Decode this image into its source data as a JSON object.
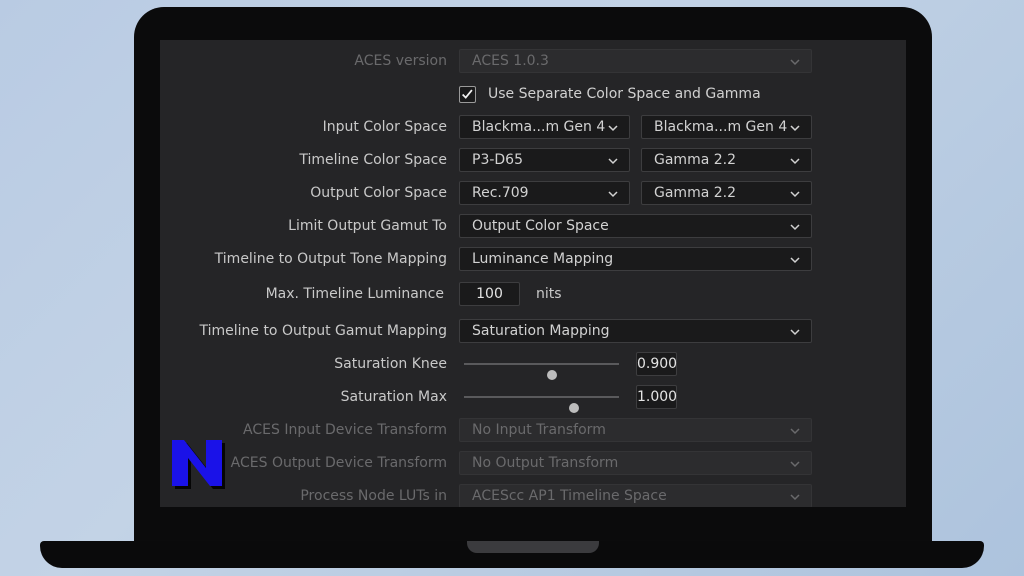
{
  "settings": {
    "aces_version": {
      "label": "ACES version",
      "value": "ACES 1.0.3"
    },
    "separate": {
      "label": "Use Separate Color Space and Gamma",
      "checked": true
    },
    "input_cs": {
      "label": "Input Color Space",
      "space": "Blackma...m Gen 4",
      "gamma": "Blackma...m Gen 4"
    },
    "timeline_cs": {
      "label": "Timeline Color Space",
      "space": "P3-D65",
      "gamma": "Gamma 2.2"
    },
    "output_cs": {
      "label": "Output Color Space",
      "space": "Rec.709",
      "gamma": "Gamma 2.2"
    },
    "limit_gamut": {
      "label": "Limit Output Gamut To",
      "value": "Output Color Space"
    },
    "tone_mapping": {
      "label": "Timeline to Output Tone Mapping",
      "value": "Luminance Mapping"
    },
    "max_luminance": {
      "label": "Max. Timeline Luminance",
      "value": "100",
      "unit": "nits"
    },
    "gamut_mapping": {
      "label": "Timeline to Output Gamut Mapping",
      "value": "Saturation Mapping"
    },
    "sat_knee": {
      "label": "Saturation Knee",
      "value": "0.900",
      "slider_fraction": 0.57
    },
    "sat_max": {
      "label": "Saturation Max",
      "value": "1.000",
      "slider_fraction": 0.71
    },
    "aces_idt": {
      "label": "ACES Input Device Transform",
      "value": "No Input Transform"
    },
    "aces_odt": {
      "label": "ACES Output Device Transform",
      "value": "No Output Transform"
    },
    "node_luts": {
      "label": "Process Node LUTs in",
      "value": "ACEScc AP1 Timeline Space"
    }
  },
  "icons": {
    "dropdown": "chevron-down-icon",
    "checkbox": "checkmark-icon",
    "logo": "n-logo-icon"
  },
  "colors": {
    "panel": "#252527",
    "field": "#1a1a1b",
    "logo": "#1a12e8"
  }
}
